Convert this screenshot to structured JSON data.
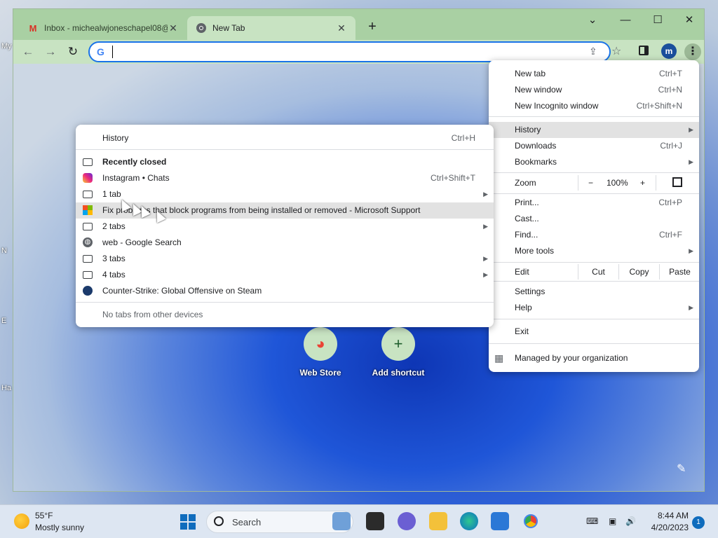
{
  "desktop": {
    "icon_labels": [
      "My",
      "N",
      "E",
      "Ha"
    ]
  },
  "tabs": [
    {
      "title": "Inbox - michealwjoneschapel08@",
      "favicon": "gmail-icon",
      "close": "✕"
    },
    {
      "title": "New Tab",
      "favicon": "chrome-icon",
      "close": "✕"
    }
  ],
  "window_controls": {
    "tab_search": "⌄",
    "minimize": "—",
    "maximize": "☐",
    "close": "✕"
  },
  "toolbar": {
    "back": "←",
    "forward": "→",
    "reload": "↻",
    "omnibox_value": "",
    "omni_logo": "G",
    "share_icon": "⇪",
    "bookmark_icon": "☆",
    "avatar_letter": "m",
    "menu_icon": "⋮",
    "new_tab_plus": "+"
  },
  "shortcuts": [
    {
      "label": "Web Store",
      "glyph": "◕"
    },
    {
      "label": "Add shortcut",
      "glyph": "+"
    }
  ],
  "main_menu": {
    "items": [
      {
        "label": "New tab",
        "shortcut": "Ctrl+T"
      },
      {
        "label": "New window",
        "shortcut": "Ctrl+N"
      },
      {
        "label": "New Incognito window",
        "shortcut": "Ctrl+Shift+N"
      },
      {
        "label": "History",
        "shortcut": ""
      },
      {
        "label": "Downloads",
        "shortcut": "Ctrl+J"
      },
      {
        "label": "Bookmarks",
        "shortcut": ""
      },
      {
        "label": "Print...",
        "shortcut": "Ctrl+P"
      },
      {
        "label": "Cast...",
        "shortcut": ""
      },
      {
        "label": "Find...",
        "shortcut": "Ctrl+F"
      },
      {
        "label": "More tools",
        "shortcut": ""
      },
      {
        "label": "Settings",
        "shortcut": ""
      },
      {
        "label": "Help",
        "shortcut": ""
      },
      {
        "label": "Exit",
        "shortcut": ""
      }
    ],
    "zoom": {
      "label": "Zoom",
      "minus": "−",
      "value": "100%",
      "plus": "+"
    },
    "edit": {
      "label": "Edit",
      "cut": "Cut",
      "copy": "Copy",
      "paste": "Paste"
    },
    "managed": "Managed by your organization",
    "submenu_arrow": "▶"
  },
  "history_menu": {
    "header": "History",
    "header_shortcut": "Ctrl+H",
    "recently_closed": "Recently closed",
    "items": [
      {
        "label": "Instagram • Chats",
        "shortcut": "Ctrl+Shift+T",
        "icon": "instagram-icon"
      },
      {
        "label": "1 tab",
        "shortcut": "",
        "icon": "tab-group-icon"
      },
      {
        "label": "Fix problems that block programs from being installed or removed - Microsoft Support",
        "shortcut": "",
        "icon": "microsoft-icon"
      },
      {
        "label": "2 tabs",
        "shortcut": "",
        "icon": "tab-group-icon"
      },
      {
        "label": "web - Google Search",
        "shortcut": "",
        "icon": "globe-icon"
      },
      {
        "label": "3 tabs",
        "shortcut": "",
        "icon": "tab-group-icon"
      },
      {
        "label": "4 tabs",
        "shortcut": "",
        "icon": "tab-group-icon"
      },
      {
        "label": "Counter-Strike: Global Offensive on Steam",
        "shortcut": "",
        "icon": "steam-icon"
      }
    ],
    "footer": "No tabs from other devices"
  },
  "taskbar": {
    "weather_temp": "55°F",
    "weather_desc": "Mostly sunny",
    "search_label": "Search",
    "time": "8:44 AM",
    "date": "4/20/2023",
    "notification_count": "1"
  },
  "colors": {
    "tabstrip": "#a9d0a3",
    "toolbar": "#c8e3c2",
    "omnibox_focus": "#1a73e8",
    "menu_highlight": "#e2e2e2"
  }
}
